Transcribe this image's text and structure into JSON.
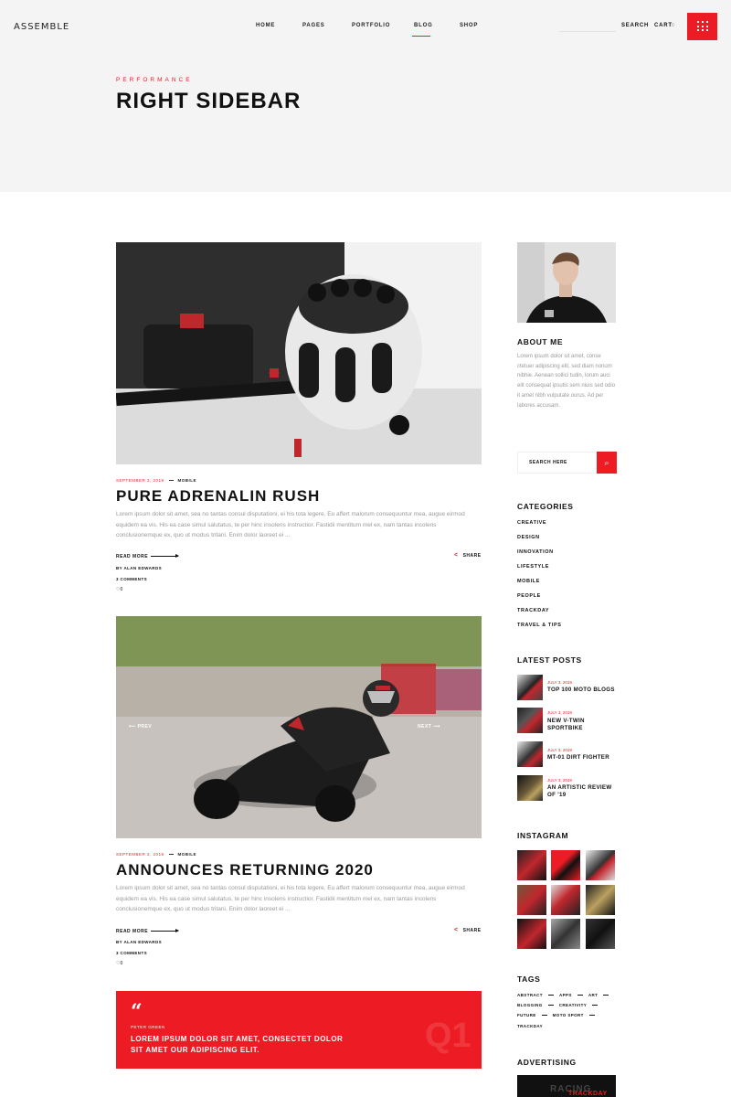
{
  "header": {
    "logo": "ASSEMBLE",
    "nav": [
      "HOME",
      "PAGES",
      "PORTFOLIO",
      "BLOG",
      "SHOP"
    ],
    "active_nav": "BLOG",
    "search_label": "SEARCH",
    "cart_label": "CART",
    "cart_count": "0",
    "kicker": "PERFORMANCE",
    "title": "RIGHT SIDEBAR"
  },
  "posts": [
    {
      "date": "SEPTEMBER 2, 2019",
      "category": "MOBILE",
      "title": "PURE ADRENALIN RUSH",
      "excerpt": "Lorem ipsum dolor sit amet, sea no tantas consul disputationi, ei his tota legere. Eu affert malorum consequuntur mea, augue eirmod equidem ea vis. His ea case simul salutatus, te per hinc insolens instructior. Fastidii mentitum mel ex, nam tantas incolens conclusionemque ex, quo ut modus tritani. Enim dolor laoreet ei ...",
      "read_more": "READ MORE",
      "share": "SHARE",
      "author": "BY ALAN EDWARDS",
      "comments": "3 COMMENTS",
      "likes": "0"
    },
    {
      "date": "SEPTEMBER 2, 2019",
      "category": "MOBILE",
      "title": "ANNOUNCES RETURNING 2020",
      "excerpt": "Lorem ipsum dolor sit amet, sea no tantas consul disputationi, ei his tota legere. Eu affert malorum consequuntur mea, augue eirmod equidem ea vis. His ea case simul salutatus, te per hinc insolens instructior. Fastidii mentitum mel ex, nam tantas incolens conclusionemque ex, quo ut modus tritani. Enim dolor laoreet ei ...",
      "read_more": "READ MORE",
      "share": "SHARE",
      "author": "BY ALAN EDWARDS",
      "comments": "3 COMMENTS",
      "likes": "0",
      "slider_prev": "PREV",
      "slider_next": "NEXT"
    }
  ],
  "quote": {
    "author": "PETER GREEN",
    "text": "LOREM IPSUM DOLOR SIT AMET, CONSECTET DOLOR SIT AMET OUR ADIPISCING ELIT.",
    "watermark": "Q1"
  },
  "sidebar": {
    "about_title": "ABOUT ME",
    "about_text": "Lorem ipsum dolor sit amet, conse ctetuer adipiscing elit, sed diam nonum nibhie. Aenean sollici tudin, lorum auci elit consequat ipsutis sem niuis sed odio it amet nibh vulputate ourus. Ad per labores accusam.",
    "search_placeholder": "SEARCH HERE",
    "categories_title": "CATEGORIES",
    "categories": [
      "CREATIVE",
      "DESIGN",
      "INNOVATION",
      "LIFESTYLE",
      "MOBILE",
      "PEOPLE",
      "TRACKDAY",
      "TRAVEL & TIPS"
    ],
    "latest_title": "LATEST POSTS",
    "latest": [
      {
        "date": "JULY 3, 2019",
        "title": "TOP 100 MOTO BLOGS"
      },
      {
        "date": "JULY 3, 2019",
        "title": "NEW V-TWIN SPORTBIKE"
      },
      {
        "date": "JULY 3, 2019",
        "title": "MT-01 DIRT FIGHTER"
      },
      {
        "date": "JULY 3, 2019",
        "title": "AN ARTISTIC REVIEW OF '19"
      }
    ],
    "instagram_title": "INSTAGRAM",
    "tags_title": "TAGS",
    "tags_rows": [
      [
        "ABSTRACT",
        "APPS",
        "ART"
      ],
      [
        "BLOGGING",
        "CREATIVITY"
      ],
      [
        "FUTURE",
        "MOTO SPORT"
      ],
      [
        "TRACKDAY"
      ]
    ],
    "advertising_title": "ADVERTISING",
    "ad_text1": "RACING",
    "ad_text2": "TRACKDAY"
  },
  "colors": {
    "accent": "#ed1c24",
    "header_bg": "#f4f4f4"
  }
}
